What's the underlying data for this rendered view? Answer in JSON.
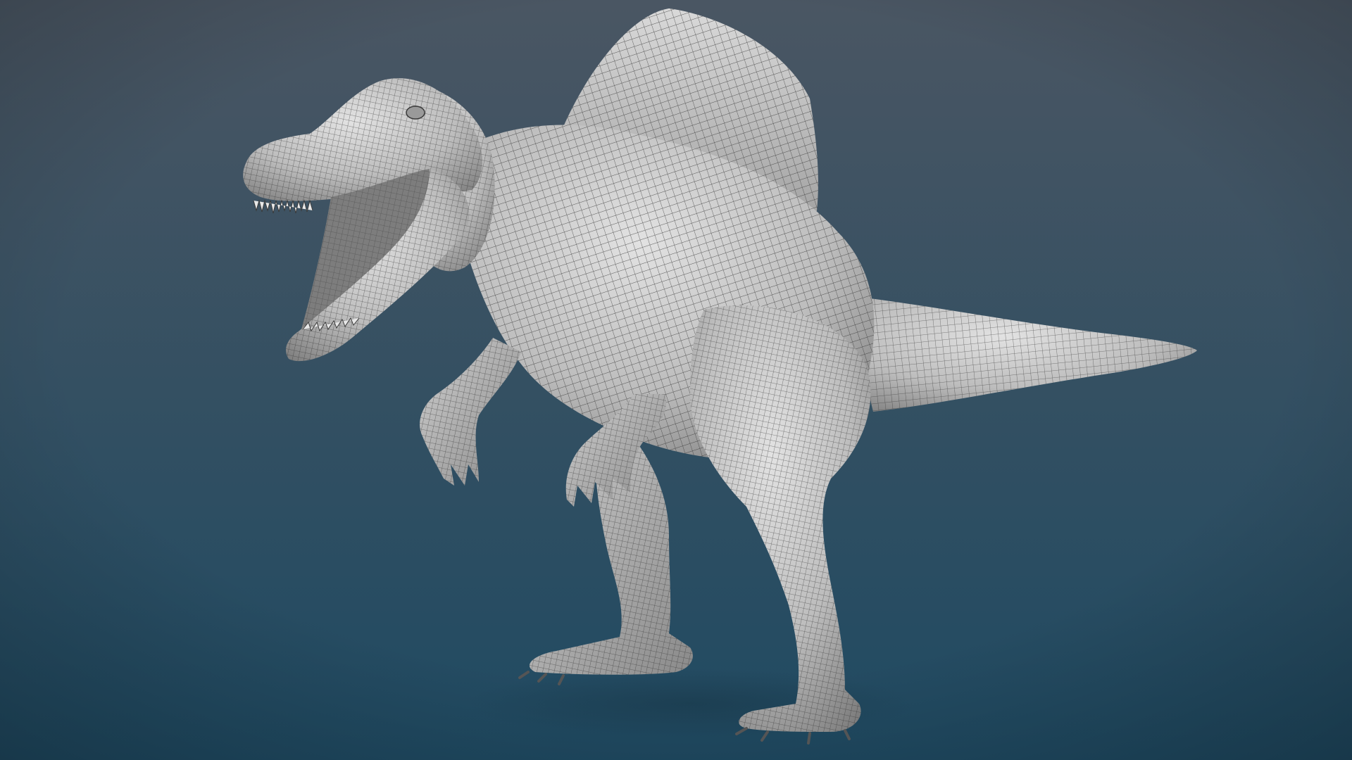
{
  "scene": {
    "subject": "spinosaurus-wireframe-model",
    "colors": {
      "background_top": "#4a5663",
      "background_bottom": "#1f4a62",
      "mesh_fill_light": "#d6d6d6",
      "mesh_fill_mid": "#a9a9a9",
      "mesh_fill_dark": "#6f6f6f",
      "mesh_line": "#2e2e2e",
      "shadow": "#183647"
    }
  }
}
